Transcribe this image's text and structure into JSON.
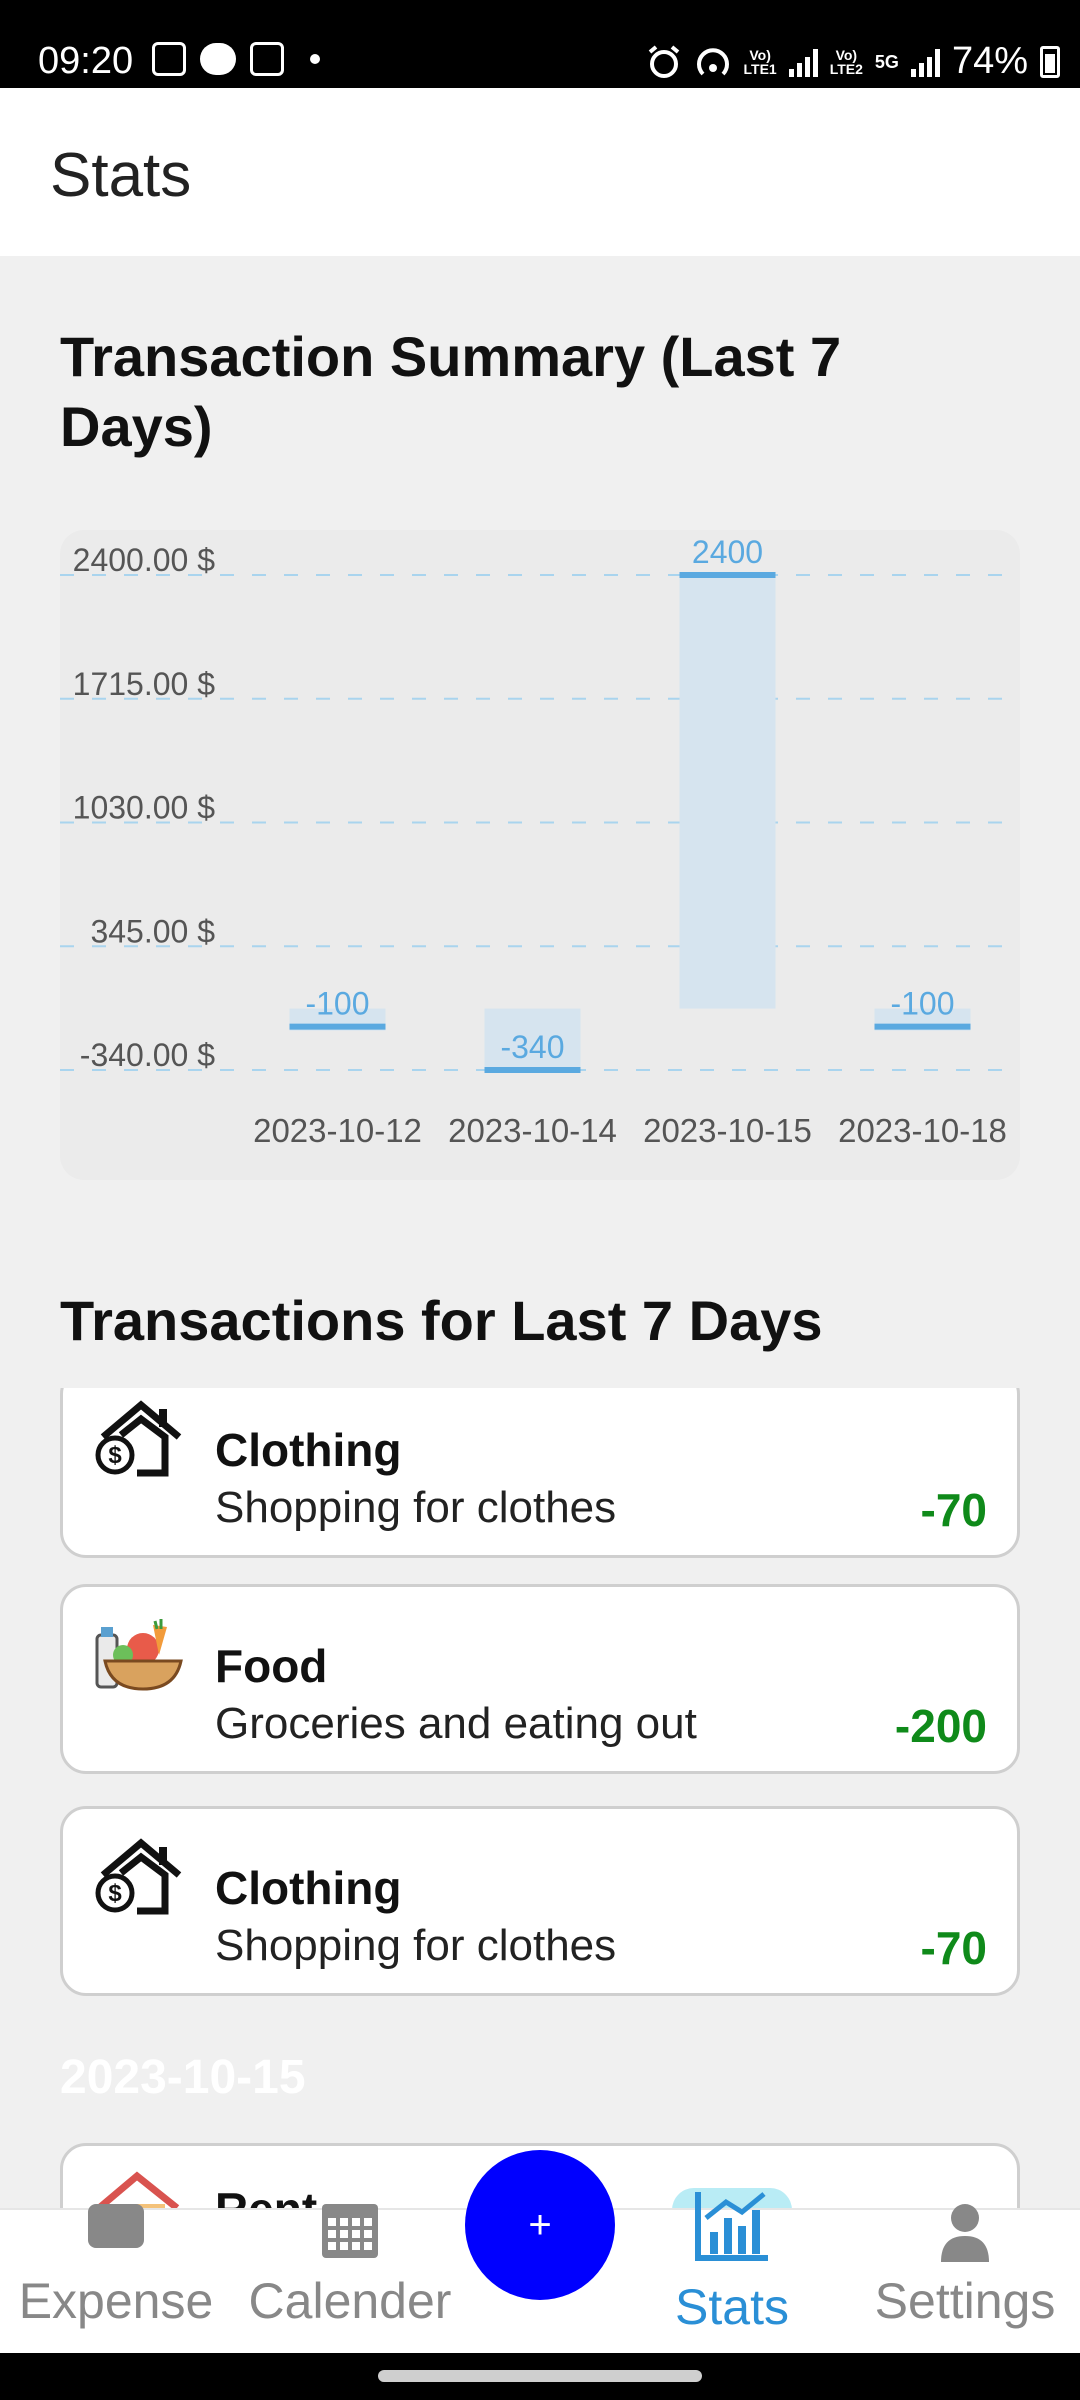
{
  "status_bar": {
    "time": "09:20",
    "battery": "74%",
    "sim1_label": "LTE1",
    "sim2_label": "LTE2",
    "network_5g": "5G"
  },
  "appbar": {
    "title": "Stats"
  },
  "summary": {
    "title": "Transaction Summary (Last 7 Days)"
  },
  "chart_data": {
    "type": "bar",
    "categories": [
      "2023-10-12",
      "2023-10-14",
      "2023-10-15",
      "2023-10-18"
    ],
    "values": [
      -100,
      -340,
      2400,
      -100
    ],
    "data_labels": [
      "-100",
      "-340",
      "2400",
      "-100"
    ],
    "ytick_labels": [
      "2400.00 $",
      "1715.00 $",
      "1030.00 $",
      "345.00 $",
      "-340.00 $"
    ],
    "yticks": [
      2400,
      1715,
      1030,
      345,
      -340
    ],
    "ylim": [
      -340,
      2400
    ],
    "grid": true,
    "bar_color": "#d6e4ef",
    "bar_top_color": "#5aa9e0",
    "label_color": "#5aa9e0"
  },
  "transactions_section": {
    "title": "Transactions for Last 7 Days",
    "items": [
      {
        "category": "Clothing",
        "description": "Shopping for clothes",
        "amount": "-70",
        "icon": "house-money-icon"
      },
      {
        "category": "Food",
        "description": "Groceries and eating out",
        "amount": "-200",
        "icon": "food-basket-icon"
      },
      {
        "category": "Clothing",
        "description": "Shopping for clothes",
        "amount": "-70",
        "icon": "house-money-icon"
      }
    ],
    "next_date_header": "2023-10-15",
    "next_item": {
      "category": "Rent",
      "icon": "house-icon"
    }
  },
  "bottom_nav": {
    "items": [
      {
        "label": "Expense",
        "icon": "wallet-icon"
      },
      {
        "label": "Calender",
        "icon": "calendar-icon"
      },
      {
        "label": "Stats",
        "icon": "chart-icon"
      },
      {
        "label": "Settings",
        "icon": "person-icon"
      }
    ],
    "fab_label": "+",
    "active_color": "#2a8fd6",
    "fab_color": "#0000ff"
  }
}
